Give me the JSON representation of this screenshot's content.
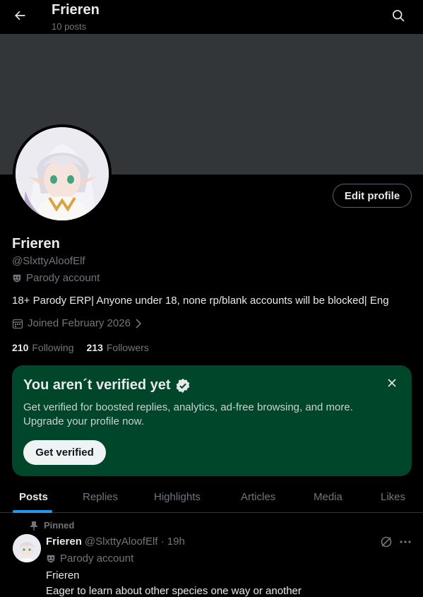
{
  "header": {
    "title": "Frieren",
    "post_count": "10 posts"
  },
  "profile": {
    "display_name": "Frieren",
    "handle": "@SlxttyAloofElf",
    "parody_label": "Parody account",
    "bio": "18+ Parody ERP| Anyone under 18, none rp/blank accounts will be blocked| Eng",
    "joined": "Joined February 2026",
    "following_count": "210",
    "following_label": "Following",
    "followers_count": "213",
    "followers_label": "Followers",
    "edit_label": "Edit profile"
  },
  "verify": {
    "title": "You aren´t verified yet",
    "text": "Get verified for boosted replies, analytics, ad-free browsing, and more. Upgrade your profile now.",
    "button": "Get verified"
  },
  "tabs": [
    "Posts",
    "Replies",
    "Highlights",
    "Articles",
    "Media",
    "Likes"
  ],
  "active_tab": "Posts",
  "post": {
    "pinned_label": "Pinned",
    "name": "Frieren",
    "meta": "@SlxttyAloofElf · 19h",
    "parody_label": "Parody account",
    "line1": "Frieren",
    "line2": "Eager to learn about other species one way or another"
  },
  "colors": {
    "accent": "#1d9bf0",
    "banner": "#333639",
    "verify_bg": "#00462a",
    "muted": "#71767b"
  }
}
